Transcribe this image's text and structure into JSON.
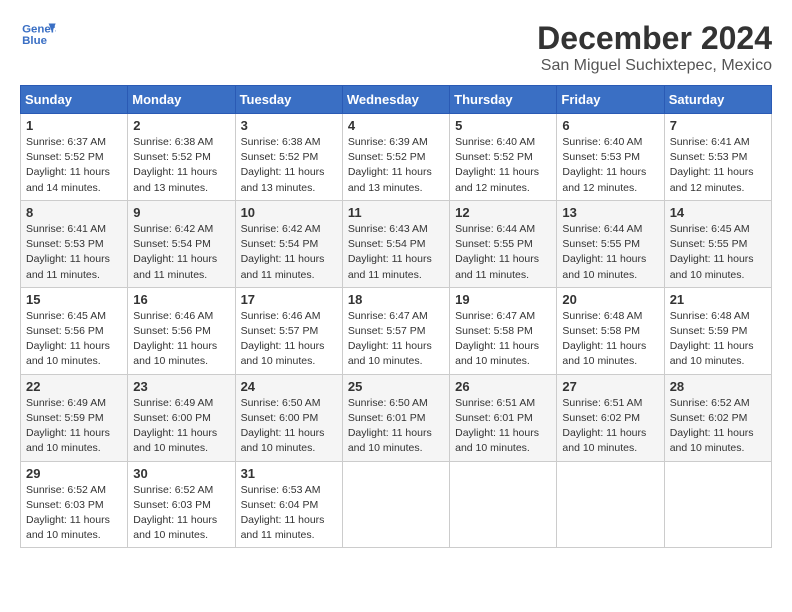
{
  "header": {
    "logo_line1": "General",
    "logo_line2": "Blue",
    "month": "December 2024",
    "location": "San Miguel Suchixtepec, Mexico"
  },
  "weekdays": [
    "Sunday",
    "Monday",
    "Tuesday",
    "Wednesday",
    "Thursday",
    "Friday",
    "Saturday"
  ],
  "weeks": [
    [
      {
        "day": "1",
        "info": "Sunrise: 6:37 AM\nSunset: 5:52 PM\nDaylight: 11 hours\nand 14 minutes."
      },
      {
        "day": "2",
        "info": "Sunrise: 6:38 AM\nSunset: 5:52 PM\nDaylight: 11 hours\nand 13 minutes."
      },
      {
        "day": "3",
        "info": "Sunrise: 6:38 AM\nSunset: 5:52 PM\nDaylight: 11 hours\nand 13 minutes."
      },
      {
        "day": "4",
        "info": "Sunrise: 6:39 AM\nSunset: 5:52 PM\nDaylight: 11 hours\nand 13 minutes."
      },
      {
        "day": "5",
        "info": "Sunrise: 6:40 AM\nSunset: 5:52 PM\nDaylight: 11 hours\nand 12 minutes."
      },
      {
        "day": "6",
        "info": "Sunrise: 6:40 AM\nSunset: 5:53 PM\nDaylight: 11 hours\nand 12 minutes."
      },
      {
        "day": "7",
        "info": "Sunrise: 6:41 AM\nSunset: 5:53 PM\nDaylight: 11 hours\nand 12 minutes."
      }
    ],
    [
      {
        "day": "8",
        "info": "Sunrise: 6:41 AM\nSunset: 5:53 PM\nDaylight: 11 hours\nand 11 minutes."
      },
      {
        "day": "9",
        "info": "Sunrise: 6:42 AM\nSunset: 5:54 PM\nDaylight: 11 hours\nand 11 minutes."
      },
      {
        "day": "10",
        "info": "Sunrise: 6:42 AM\nSunset: 5:54 PM\nDaylight: 11 hours\nand 11 minutes."
      },
      {
        "day": "11",
        "info": "Sunrise: 6:43 AM\nSunset: 5:54 PM\nDaylight: 11 hours\nand 11 minutes."
      },
      {
        "day": "12",
        "info": "Sunrise: 6:44 AM\nSunset: 5:55 PM\nDaylight: 11 hours\nand 11 minutes."
      },
      {
        "day": "13",
        "info": "Sunrise: 6:44 AM\nSunset: 5:55 PM\nDaylight: 11 hours\nand 10 minutes."
      },
      {
        "day": "14",
        "info": "Sunrise: 6:45 AM\nSunset: 5:55 PM\nDaylight: 11 hours\nand 10 minutes."
      }
    ],
    [
      {
        "day": "15",
        "info": "Sunrise: 6:45 AM\nSunset: 5:56 PM\nDaylight: 11 hours\nand 10 minutes."
      },
      {
        "day": "16",
        "info": "Sunrise: 6:46 AM\nSunset: 5:56 PM\nDaylight: 11 hours\nand 10 minutes."
      },
      {
        "day": "17",
        "info": "Sunrise: 6:46 AM\nSunset: 5:57 PM\nDaylight: 11 hours\nand 10 minutes."
      },
      {
        "day": "18",
        "info": "Sunrise: 6:47 AM\nSunset: 5:57 PM\nDaylight: 11 hours\nand 10 minutes."
      },
      {
        "day": "19",
        "info": "Sunrise: 6:47 AM\nSunset: 5:58 PM\nDaylight: 11 hours\nand 10 minutes."
      },
      {
        "day": "20",
        "info": "Sunrise: 6:48 AM\nSunset: 5:58 PM\nDaylight: 11 hours\nand 10 minutes."
      },
      {
        "day": "21",
        "info": "Sunrise: 6:48 AM\nSunset: 5:59 PM\nDaylight: 11 hours\nand 10 minutes."
      }
    ],
    [
      {
        "day": "22",
        "info": "Sunrise: 6:49 AM\nSunset: 5:59 PM\nDaylight: 11 hours\nand 10 minutes."
      },
      {
        "day": "23",
        "info": "Sunrise: 6:49 AM\nSunset: 6:00 PM\nDaylight: 11 hours\nand 10 minutes."
      },
      {
        "day": "24",
        "info": "Sunrise: 6:50 AM\nSunset: 6:00 PM\nDaylight: 11 hours\nand 10 minutes."
      },
      {
        "day": "25",
        "info": "Sunrise: 6:50 AM\nSunset: 6:01 PM\nDaylight: 11 hours\nand 10 minutes."
      },
      {
        "day": "26",
        "info": "Sunrise: 6:51 AM\nSunset: 6:01 PM\nDaylight: 11 hours\nand 10 minutes."
      },
      {
        "day": "27",
        "info": "Sunrise: 6:51 AM\nSunset: 6:02 PM\nDaylight: 11 hours\nand 10 minutes."
      },
      {
        "day": "28",
        "info": "Sunrise: 6:52 AM\nSunset: 6:02 PM\nDaylight: 11 hours\nand 10 minutes."
      }
    ],
    [
      {
        "day": "29",
        "info": "Sunrise: 6:52 AM\nSunset: 6:03 PM\nDaylight: 11 hours\nand 10 minutes."
      },
      {
        "day": "30",
        "info": "Sunrise: 6:52 AM\nSunset: 6:03 PM\nDaylight: 11 hours\nand 10 minutes."
      },
      {
        "day": "31",
        "info": "Sunrise: 6:53 AM\nSunset: 6:04 PM\nDaylight: 11 hours\nand 11 minutes."
      },
      null,
      null,
      null,
      null
    ]
  ]
}
